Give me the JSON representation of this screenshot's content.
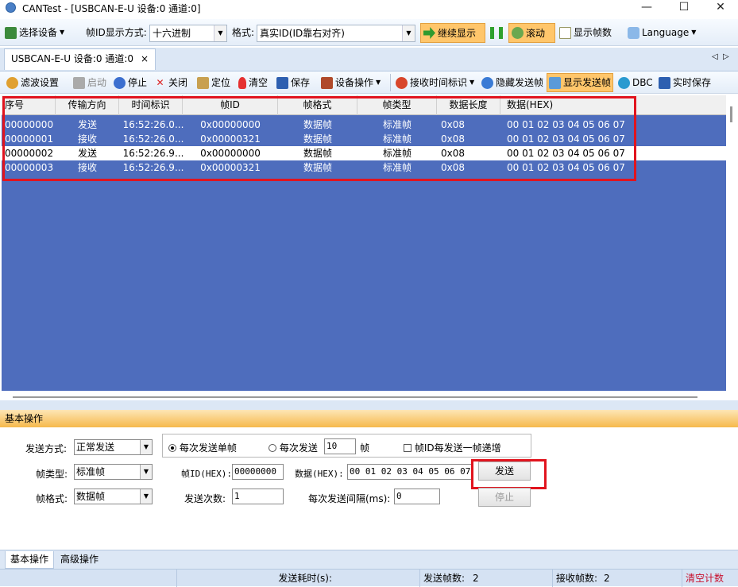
{
  "window": {
    "title": "CANTest  - [USBCAN-E-U 设备:0 通道:0]",
    "minimize_glyph": "—",
    "maximize_glyph": "☐",
    "close_glyph": "✕"
  },
  "toolbar1": {
    "select_device": "选择设备",
    "frame_id_mode_label": "帧ID显示方式:",
    "frame_id_mode_value": "十六进制",
    "format_label": "格式:",
    "format_value": "真实ID(ID靠右对齐)",
    "continue_display": "继续显示",
    "scroll": "滚动",
    "show_frame_count": "显示帧数",
    "language": "Language",
    "accent_color": "#ffc66b"
  },
  "doc_tab": {
    "label": "USBCAN-E-U 设备:0 通道:0",
    "close": "×"
  },
  "tab_nav": {
    "prev": "◁",
    "next": "▷"
  },
  "toolbar2": {
    "filter_settings": "滤波设置",
    "start": "启动",
    "stop": "停止",
    "close": "关闭",
    "locate": "定位",
    "clear": "清空",
    "save": "保存",
    "device_ops": "设备操作",
    "recv_timestamp": "接收时间标识",
    "hide_send_frames": "隐藏发送帧",
    "show_send_frames": "显示发送帧",
    "dbc": "DBC",
    "realtime_save": "实时保存"
  },
  "grid": {
    "columns": [
      "序号",
      "传输方向",
      "时间标识",
      "帧ID",
      "帧格式",
      "帧类型",
      "数据长度",
      "数据(HEX)"
    ],
    "rows": [
      {
        "seq": "00000000",
        "dir": "发送",
        "time": "16:52:26.0...",
        "id": "0x00000000",
        "fmt": "数据帧",
        "type": "标准帧",
        "len": "0x08",
        "data": "00 01 02 03 04 05 06 07"
      },
      {
        "seq": "00000001",
        "dir": "接收",
        "time": "16:52:26.0...",
        "id": "0x00000321",
        "fmt": "数据帧",
        "type": "标准帧",
        "len": "0x08",
        "data": "00 01 02 03 04 05 06 07"
      },
      {
        "seq": "00000002",
        "dir": "发送",
        "time": "16:52:26.9...",
        "id": "0x00000000",
        "fmt": "数据帧",
        "type": "标准帧",
        "len": "0x08",
        "data": "00 01 02 03 04 05 06 07"
      },
      {
        "seq": "00000003",
        "dir": "接收",
        "time": "16:52:26.9...",
        "id": "0x00000321",
        "fmt": "数据帧",
        "type": "标准帧",
        "len": "0x08",
        "data": "00 01 02 03 04 05 06 07"
      }
    ],
    "selection_color": "#4e6dbd"
  },
  "basic_panel": {
    "header": "基本操作",
    "send_mode_label": "发送方式:",
    "send_mode_value": "正常发送",
    "radio_single": "每次发送单帧",
    "radio_multi": "每次发送",
    "multi_count": "10",
    "frame_unit": "帧",
    "inc_id_label": "帧ID每发送一帧递增",
    "frame_type_label": "帧类型:",
    "frame_type_value": "标准帧",
    "frame_id_label": "帧ID(HEX):",
    "frame_id_value": "00000000",
    "data_label": "数据(HEX):",
    "data_value": "00 01 02 03 04 05 06 07",
    "send_button": "发送",
    "frame_format_label": "帧格式:",
    "frame_format_value": "数据帧",
    "send_count_label": "发送次数:",
    "send_count_value": "1",
    "interval_label": "每次发送间隔(ms):",
    "interval_value": "0",
    "stop_button": "停止"
  },
  "bottom_tabs": {
    "basic": "基本操作",
    "advanced": "高级操作"
  },
  "status_bar": {
    "send_time_label": "发送耗时(s):",
    "send_frames_label": "发送帧数:",
    "send_frames_value": "2",
    "recv_frames_label": "接收帧数:",
    "recv_frames_value": "2",
    "clear_count": "清空计数",
    "clear_color": "#c8102e"
  }
}
